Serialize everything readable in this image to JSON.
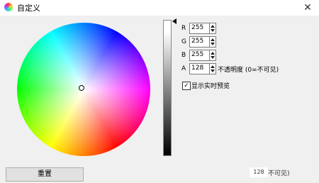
{
  "window": {
    "title": "自定义",
    "close_glyph": "✕"
  },
  "channels": [
    {
      "label": "R",
      "value": "255"
    },
    {
      "label": "G",
      "value": "255"
    },
    {
      "label": "B",
      "value": "255"
    },
    {
      "label": "A",
      "value": "128"
    }
  ],
  "alpha_hint": "不透明度 (0=不可见)",
  "preview_checkbox": {
    "label": "显示实时预览",
    "checked": true,
    "check_glyph": "✓"
  },
  "reset_button": {
    "label": "重置"
  },
  "overlay": {
    "value": "128",
    "text": "不可见)"
  },
  "icons": {
    "app": "color-wheel-icon",
    "close": "close-icon",
    "check": "check-icon"
  }
}
